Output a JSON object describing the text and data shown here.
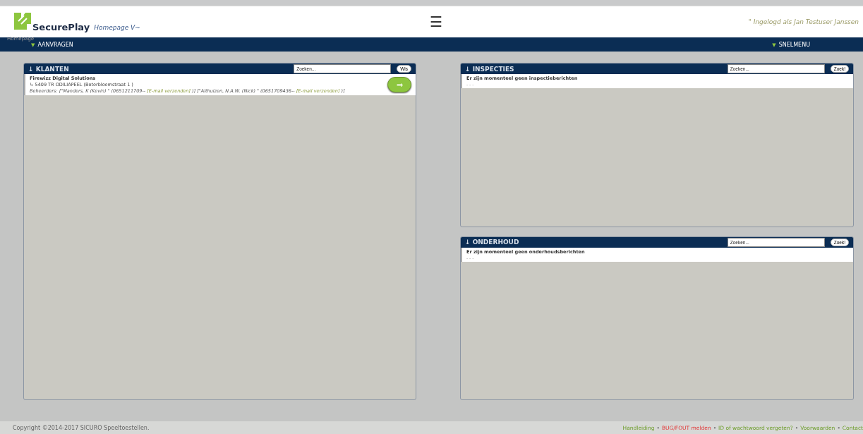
{
  "header": {
    "logo_text": "SecurePlay",
    "page_title": "Homepage V~",
    "user": "\" Ingelogd als Jan Testuser Janssen",
    "breadcrumb": "Homepage",
    "menu_icon": "☰"
  },
  "nav": [
    {
      "label": "AANVRAGEN",
      "marker": "▼"
    },
    {
      "label": "SNELMENU",
      "marker": "▼"
    }
  ],
  "columns": [
    {
      "panels": [
        {
          "title": "KLANTEN",
          "arrow": "↓",
          "placeholder": "Zoeken...",
          "button": "Wis",
          "items": [
            {
              "kind": "client",
              "name": "Firewizz Digital Solutions",
              "address": "↳ 5409 TR ODILIAPEEL (Boterbloemstraat 1 )",
              "managers": [
                {
                  "kind": "text",
                  "text": "Beheerders: [\"Manders, K (Kevin) \" (0651211709-- "
                },
                {
                  "kind": "link",
                  "text": "[E-mail verzenden]"
                },
                {
                  "kind": "text",
                  "text": " )] [\"Althuizen, N.A.W. (Nick) \" (0651709436-- "
                },
                {
                  "kind": "link",
                  "text": "[E-mail verzenden]"
                },
                {
                  "kind": "text",
                  "text": " )]"
                }
              ],
              "action": "⇒"
            }
          ]
        }
      ]
    },
    {
      "panels": [
        {
          "title": "INSPECTIES",
          "arrow": "↓",
          "placeholder": "Zoeken...",
          "button": "Zoek!",
          "items": [
            {
              "kind": "message",
              "text": "Er zijn momenteel geen inspectieberichten",
              "sub": "- - -"
            }
          ]
        },
        {
          "title": "ONDERHOUD",
          "arrow": "↓",
          "placeholder": "Zoeken...",
          "button": "Zoek!",
          "items": [
            {
              "kind": "message",
              "text": "Er zijn momenteel geen onderhoudsberichten",
              "sub": "- - -"
            }
          ]
        }
      ]
    }
  ],
  "footer": {
    "copyright": "Copyright ©2014-2017 SICURO Speeltoestellen.",
    "links": [
      {
        "text": "Handleiding",
        "kind": "normal"
      },
      {
        "text": "BUG/FOUT melden",
        "kind": "alert"
      },
      {
        "text": "ID of wachtwoord vergeten?",
        "kind": "normal"
      },
      {
        "text": "Voorwaarden",
        "kind": "normal"
      },
      {
        "text": "Contact",
        "kind": "normal"
      }
    ],
    "separator": "•"
  }
}
